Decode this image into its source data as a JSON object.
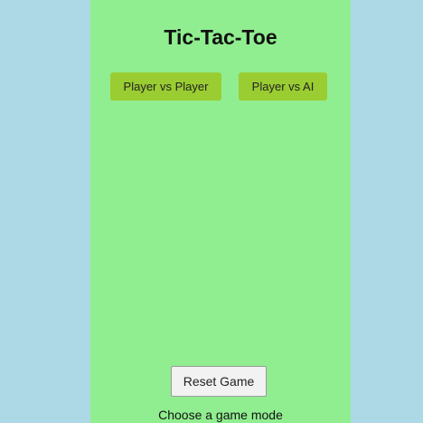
{
  "game": {
    "title": "Tic-Tac-Toe",
    "modes": {
      "player_vs_player": "Player vs Player",
      "player_vs_ai": "Player vs AI"
    },
    "reset_label": "Reset Game",
    "status": "Choose a game mode"
  },
  "colors": {
    "page_background": "#add8e6",
    "panel_background": "#90ee90",
    "mode_button": "#9acd32",
    "reset_button": "#f2f2f2"
  }
}
